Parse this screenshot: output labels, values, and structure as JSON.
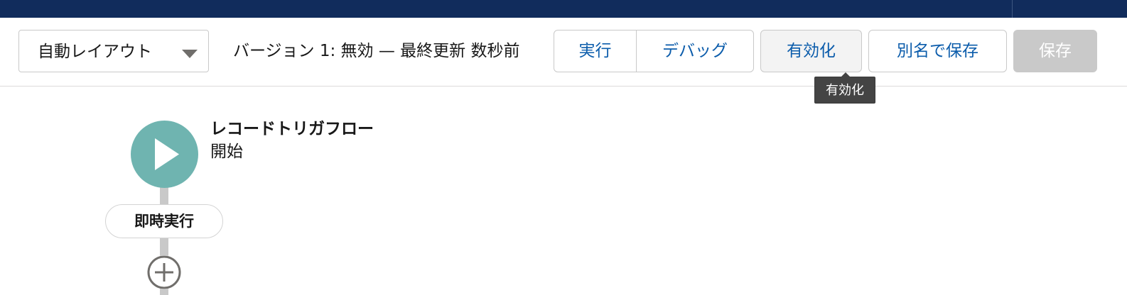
{
  "toolbar": {
    "layout_select": {
      "value": "自動レイアウト",
      "icon": "chevron-down-icon"
    },
    "version_status": "バージョン 1: 無効 — 最終更新 数秒前",
    "run_label": "実行",
    "debug_label": "デバッグ",
    "activate_label": "有効化",
    "save_as_label": "別名で保存",
    "save_label": "保存"
  },
  "tooltip": {
    "text": "有効化"
  },
  "canvas": {
    "start_node": {
      "title": "レコードトリガフロー",
      "subtitle": "開始",
      "icon": "play-icon",
      "color": "#6fb4b0"
    },
    "timing_pill": {
      "label": "即時実行"
    },
    "add_element": {
      "icon": "add-circle-icon"
    }
  },
  "colors": {
    "header_bg": "#112c5c",
    "link_blue": "#0b5cab",
    "disabled_bg": "#c9c9c9"
  }
}
